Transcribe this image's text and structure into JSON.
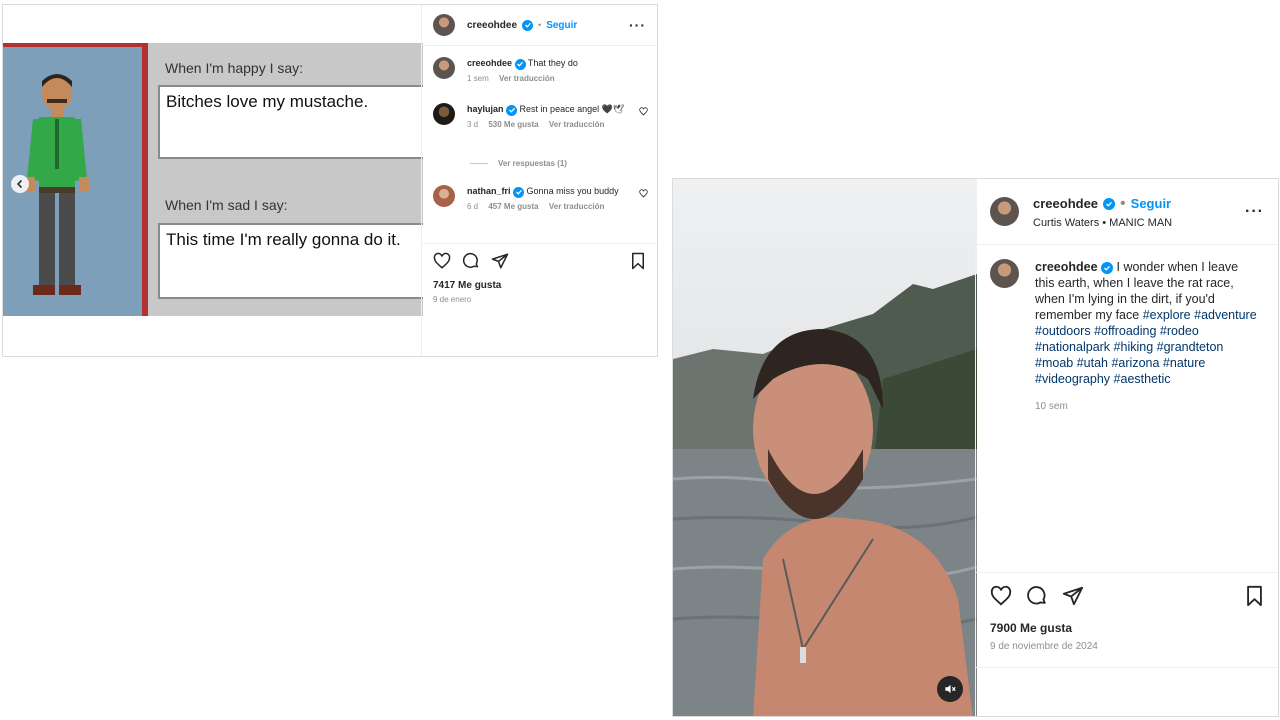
{
  "post1": {
    "username": "creeohdee",
    "follow_label": "Seguir",
    "meme": {
      "happy_label": "When I'm happy I say:",
      "happy_text": "Bitches love my mustache.",
      "sad_label": "When I'm sad I say:",
      "sad_text": "This time I'm really gonna do it."
    },
    "comments": [
      {
        "username": "creeohdee",
        "text": "That they do",
        "time": "1 sem",
        "translate": "Ver traducción"
      },
      {
        "username": "haylujan",
        "text": "Rest in peace angel 🖤🕊",
        "time": "3 d",
        "likes": "530 Me gusta",
        "translate": "Ver traducción",
        "replies": "Ver respuestas (1)"
      },
      {
        "username": "nathan_fri",
        "text": "Gonna miss you buddy",
        "time": "6 d",
        "likes": "457 Me gusta",
        "translate": "Ver traducción"
      }
    ],
    "likes": "7417 Me gusta",
    "date": "9 de enero"
  },
  "post2": {
    "username": "creeohdee",
    "follow_label": "Seguir",
    "audio": "Curtis Waters • MANIC MAN",
    "caption_text": "I wonder when I leave this earth, when I leave the rat race, when I'm lying in the dirt, if you'd remember my face",
    "hashtags": [
      "#explore",
      "#adventure",
      "#outdoors",
      "#offroading",
      "#rodeo",
      "#nationalpark",
      "#hiking",
      "#grandteton",
      "#moab",
      "#utah",
      "#arizona",
      "#nature",
      "#videography",
      "#aesthetic"
    ],
    "caption_time": "10 sem",
    "likes": "7900 Me gusta",
    "date": "9 de noviembre de 2024"
  },
  "icons": [
    "heart-icon",
    "comment-icon",
    "share-icon",
    "bookmark-icon",
    "more-icon",
    "verified-icon",
    "chevron-left-icon",
    "mute-icon"
  ],
  "colors": {
    "accent": "#0095f6",
    "hashtag": "#00376b",
    "muted": "#8e8e8e"
  }
}
